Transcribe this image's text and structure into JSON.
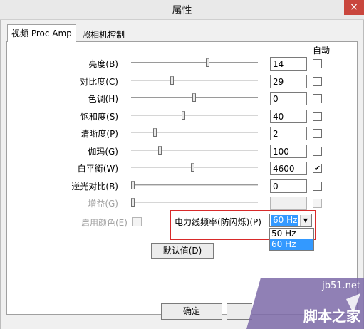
{
  "window": {
    "title": "属性",
    "close_glyph": "×"
  },
  "tabs": [
    {
      "label": "视频 Proc Amp",
      "active": true
    },
    {
      "label": "照相机控制",
      "active": false
    }
  ],
  "auto_header": "自动",
  "rows": [
    {
      "label": "亮度(B)",
      "value": "14",
      "slider": 0.61,
      "checked": false,
      "disabled": false
    },
    {
      "label": "对比度(C)",
      "value": "29",
      "slider": 0.32,
      "checked": false,
      "disabled": false
    },
    {
      "label": "色调(H)",
      "value": "0",
      "slider": 0.5,
      "checked": false,
      "disabled": false
    },
    {
      "label": "饱和度(S)",
      "value": "40",
      "slider": 0.41,
      "checked": false,
      "disabled": false
    },
    {
      "label": "清晰度(P)",
      "value": "2",
      "slider": 0.18,
      "checked": false,
      "disabled": false
    },
    {
      "label": "伽玛(G)",
      "value": "100",
      "slider": 0.22,
      "checked": false,
      "disabled": false
    },
    {
      "label": "白平衡(W)",
      "value": "4600",
      "slider": 0.49,
      "checked": true,
      "disabled": false
    },
    {
      "label": "逆光对比(B)",
      "value": "0",
      "slider": 0.0,
      "checked": false,
      "disabled": false
    },
    {
      "label": "增益(G)",
      "value": "",
      "slider": 0.0,
      "checked": false,
      "disabled": true
    }
  ],
  "color_enable": {
    "label": "启用颜色(E)",
    "checked": false,
    "disabled": true
  },
  "power_line": {
    "label": "电力线频率(防闪烁)(P)",
    "selected": "60 Hz",
    "options": [
      "50 Hz",
      "60 Hz"
    ],
    "highlighted_option": "60 Hz"
  },
  "default_button": "默认值(D)",
  "ok_button": "确定",
  "check_glyph": "✔",
  "arrow_glyph": "▼",
  "watermark": {
    "domain": "jb51.net",
    "name": "脚本之家"
  }
}
